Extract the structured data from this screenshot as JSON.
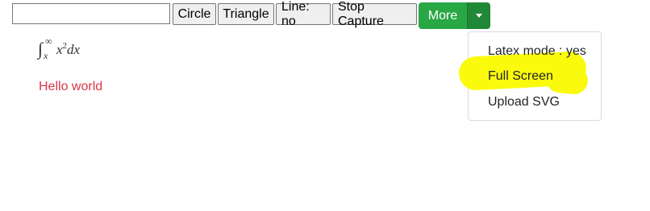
{
  "toolbar": {
    "text_input_value": "",
    "circle_label": "Circle",
    "triangle_label": "Triangle",
    "line_label": "Line: no",
    "stop_capture_label": "Stop Capture",
    "more_label": "More",
    "more_color": "#28a745"
  },
  "canvas": {
    "formula": {
      "integral_symbol": "∫",
      "upper_limit": "∞",
      "lower_limit": "x",
      "integrand_base": "x",
      "integrand_power": "2",
      "differential": "dx"
    },
    "hello_text": "Hello world",
    "hello_color": "#dc3545"
  },
  "dropdown": {
    "items": [
      {
        "label": "Latex mode : yes"
      },
      {
        "label": "Full Screen"
      },
      {
        "label": "Upload SVG"
      }
    ],
    "highlight_color": "#fafa0d"
  }
}
